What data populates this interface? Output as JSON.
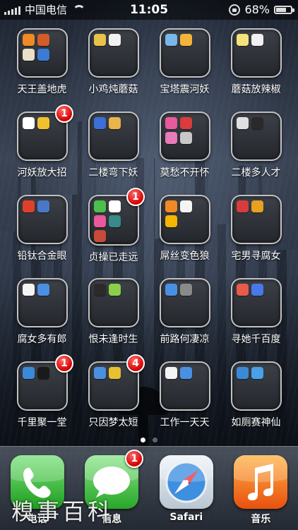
{
  "status_bar": {
    "carrier": "中国电信",
    "time": "11:05",
    "battery": "68%",
    "battery_level": 0.68,
    "signal_bars": 5
  },
  "folders": [
    {
      "label": "天王盖地虎",
      "badge": "",
      "icons": [
        "#f08a24",
        "#d45b2a",
        "#e9e0c8",
        "#3a7bd5"
      ]
    },
    {
      "label": "小鸡炖蘑菇",
      "badge": "",
      "icons": [
        "#e8c34a",
        "#f1f1f1"
      ]
    },
    {
      "label": "宝塔震河妖",
      "badge": "",
      "icons": [
        "#7ab6e8",
        "#f4b43c"
      ]
    },
    {
      "label": "蘑菇放辣椒",
      "badge": "",
      "icons": [
        "#f4e27a",
        "#f0f0f0"
      ]
    },
    {
      "label": "河妖放大招",
      "badge": "1",
      "icons": [
        "#ffffff",
        "#f0c030"
      ]
    },
    {
      "label": "二楼弯下妖",
      "badge": "",
      "icons": [
        "#3c6fd8",
        "#e8b44c"
      ]
    },
    {
      "label": "莫愁不开怀",
      "badge": "",
      "icons": [
        "#e85a9a",
        "#d83c3c",
        "#e87ab8",
        "#c8c8c8"
      ]
    },
    {
      "label": "二楼多人才",
      "badge": "",
      "icons": [
        "#e0e0e0",
        "#2a2a2a"
      ]
    },
    {
      "label": "铅钛合金眼",
      "badge": "",
      "icons": [
        "#e0402a",
        "#4a78c8"
      ]
    },
    {
      "label": "贞操已走远",
      "badge": "1",
      "icons": [
        "#4cc04c",
        "#ffffff",
        "#e85a9a",
        "#3a8a8a",
        "#c84a3a"
      ]
    },
    {
      "label": "屌丝变色狼",
      "badge": "",
      "icons": [
        "#f08a24",
        "#f4f4f4",
        "#f4b400"
      ]
    },
    {
      "label": "宅男寻腐女",
      "badge": "",
      "icons": [
        "#d83c3c",
        "#e8a020"
      ]
    },
    {
      "label": "腐女多有郎",
      "badge": "",
      "icons": [
        "#f4f4f4",
        "#4a90e2"
      ]
    },
    {
      "label": "恨未逢时生",
      "badge": "",
      "icons": [
        "#2a2a2a",
        "#8ad04a"
      ]
    },
    {
      "label": "前路何凄凉",
      "badge": "",
      "icons": [
        "#4a90e2",
        "#8a8a8a"
      ]
    },
    {
      "label": "寻她千百度",
      "badge": "",
      "icons": [
        "#e85a4a",
        "#4a78e8"
      ]
    },
    {
      "label": "千里聚一堂",
      "badge": "1",
      "icons": [
        "#3a8ad8",
        "#1a1a1a"
      ]
    },
    {
      "label": "只因梦太短",
      "badge": "4",
      "icons": [
        "#4a90e2",
        "#e8c030"
      ]
    },
    {
      "label": "工作一天天",
      "badge": "",
      "icons": [
        "#f4f4f4",
        "#4a90e2"
      ]
    },
    {
      "label": "如厕赛神仙",
      "badge": "",
      "icons": [
        "#3a8ad8",
        "#4aa0e8"
      ]
    }
  ],
  "page_dots": {
    "count": 2,
    "active": 0
  },
  "dock": [
    {
      "label": "电话",
      "badge": "",
      "icon": "phone-icon"
    },
    {
      "label": "信息",
      "badge": "1",
      "icon": "messages-icon"
    },
    {
      "label": "Safari",
      "badge": "",
      "icon": "safari-icon"
    },
    {
      "label": "音乐",
      "badge": "",
      "icon": "music-icon"
    }
  ],
  "watermark": "糗事百科"
}
